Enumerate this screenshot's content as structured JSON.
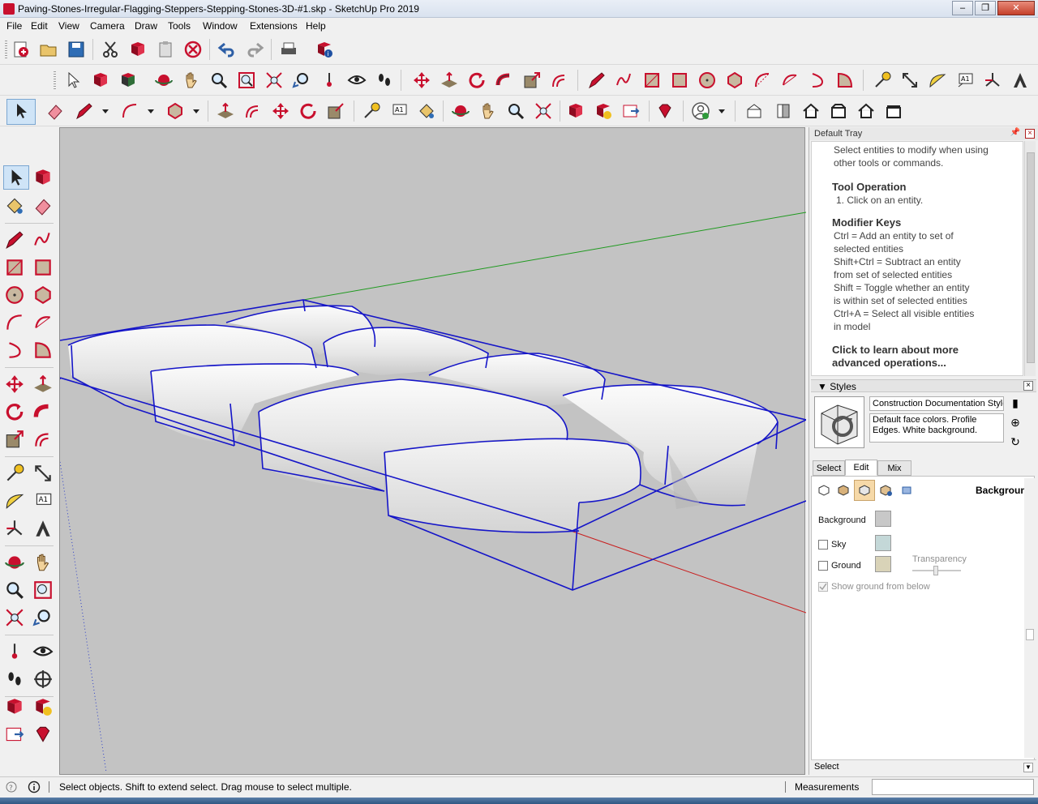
{
  "window": {
    "title": "Paving-Stones-Irregular-Flagging-Steppers-Stepping-Stones-3D-#1.skp - SketchUp Pro 2019",
    "controls": [
      "minimize",
      "restore",
      "close"
    ]
  },
  "menu": [
    "File",
    "Edit",
    "View",
    "Camera",
    "Draw",
    "Tools",
    "Window",
    "Extensions",
    "Help"
  ],
  "right_tray": {
    "title": "Default Tray",
    "instructor": {
      "intro": "Select entities to modify when using other tools or commands.",
      "tool_operation_heading": "Tool Operation",
      "tool_operation_step": "1. Click on an entity.",
      "modifier_heading": "Modifier Keys",
      "modifier_lines": [
        "Ctrl = Add an entity to set of",
        "selected entities",
        "Shift+Ctrl = Subtract an entity",
        "from set of selected entities",
        "Shift = Toggle whether an entity",
        "is within set of selected entities",
        "Ctrl+A = Select all visible entities",
        "in model"
      ],
      "link_line1": "Click to learn about more",
      "link_line2": "advanced operations..."
    },
    "styles": {
      "heading": "Styles",
      "style_name": "Construction Documentation Style",
      "style_description": "Default face colors. Profile Edges. White background.",
      "tabs": [
        "Select",
        "Edit",
        "Mix"
      ],
      "active_tab": "Edit",
      "edit_section_title": "Background",
      "background_label": "Background",
      "sky_label": "Sky",
      "ground_label": "Ground",
      "transparency_label": "Transparency",
      "show_ground_label": "Show ground from below",
      "sky_checked": false,
      "ground_checked": false,
      "show_ground_checked": true,
      "colors": {
        "background": "#c8c8c8",
        "sky": "#c4d8d8",
        "ground": "#d9d3b8"
      }
    },
    "footer_label": "Select"
  },
  "status": {
    "hint": "Select objects. Shift to extend select. Drag mouse to select multiple.",
    "measurements_label": "Measurements",
    "measurements_value": ""
  },
  "colors": {
    "viewport_bg": "#c3c3c3",
    "selection_blue": "#1515c8",
    "axis_green": "#1f9a1f",
    "axis_red": "#c81e1e",
    "icon_red": "#c8102e"
  },
  "left_tools": [
    "select",
    "make-component",
    "paint-bucket",
    "eraser",
    "line",
    "freehand",
    "rectangle",
    "rotated-rectangle",
    "circle",
    "polygon",
    "arc",
    "2-point-arc",
    "3-point-arc",
    "pie",
    "move",
    "push-pull",
    "rotate",
    "follow-me",
    "scale",
    "offset",
    "tape-measure",
    "dimension",
    "protractor",
    "text",
    "axes",
    "3d-text",
    "orbit",
    "pan",
    "zoom",
    "zoom-window",
    "zoom-extents",
    "previous",
    "position-camera",
    "look-around",
    "walk",
    "section-plane",
    "warehouse",
    "extension-warehouse",
    "send-to-layout",
    "extension-manager"
  ]
}
